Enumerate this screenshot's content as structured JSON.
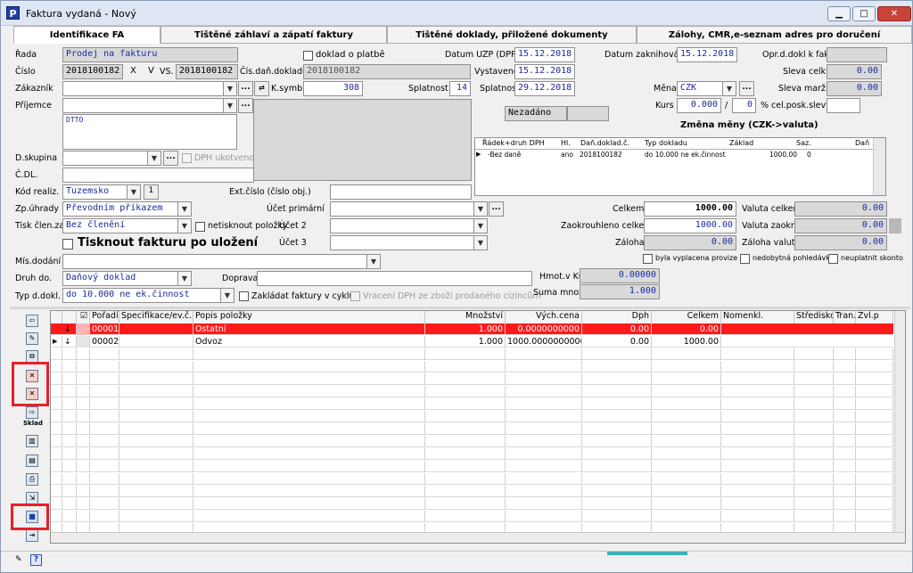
{
  "window": {
    "title": "Faktura vydaná - Nový",
    "app_logo": "P",
    "min": "▁",
    "max": "□",
    "close": "✕"
  },
  "tabs": [
    "Identifikace FA",
    "Tištěné záhlaví a zápatí faktury",
    "Tištěné doklady, přiložené dokumenty",
    "Zálohy, CMR,e-seznam adres pro doručení"
  ],
  "form": {
    "rada_label": "Řada",
    "rada_value": "Prodej na fakturu",
    "doklad_o_platbe": "doklad o platbě",
    "cislo_label": "Číslo",
    "cislo_value": "2018100182",
    "x_label": "X",
    "v_label": "V",
    "vs_label": "VS.",
    "vs_value": "2018100182",
    "cis_dan_label": "Čís.daň.dokladu",
    "cis_dan_value": "2018100182",
    "zakaznik_label": "Zákazník",
    "ksymb_label": "K.symb.",
    "ksymb_value": "308",
    "splatnost_label": "Splatnost",
    "splatnost_value": "14",
    "prijemce_label": "Příjemce",
    "prijemce_text": "DTTO",
    "dskupina_label": "D.skupina",
    "dph_ukotveno": "DPH ukotveno",
    "cdl_label": "Č.DL.",
    "kod_real_label": "Kód realiz.",
    "kod_real_value": "Tuzemsko",
    "kod_real_num": "1",
    "ext_cislo_label": "Ext.číslo (číslo obj.)",
    "zp_uhrady_label": "Zp.úhrady",
    "zp_uhrady_value": "Převodním příkazem",
    "ucet_prim_label": "Účet primární",
    "tisk_clen_label": "Tisk člen.za",
    "tisk_clen_value": "Bez členění",
    "netisknout_label": "netisknout položky",
    "ucet2_label": "Účet 2",
    "ucet3_label": "Účet 3",
    "tisknout_po_ulozeni": "Tisknout fakturu po uložení",
    "mis_dodani_label": "Mís.dodání",
    "druh_do_label": "Druh do.",
    "druh_do_value": "Daňový doklad",
    "doprava_label": "Doprava",
    "typ_dokl_label": "Typ d.dokl.",
    "typ_dokl_value": "do 10.000  ne ek.činnost",
    "zakladat_label": "Zakládat faktury v cyklu",
    "vraceni_label": "Vracení DPH ze zboží prodaného cizincům",
    "datum_uzp_label": "Datum UZP (DPPD)",
    "datum_uzp_value": "15.12.2018",
    "vystaveno_label": "Vystaveno",
    "vystaveno_value": "15.12.2018",
    "splatnost_d_label": "Splatnost",
    "splatnost_d_value": "29.12.2018",
    "datum_zak_label": "Datum zaknihování",
    "datum_zak_value": "15.12.2018",
    "opr_label": "Opr.d.dokl k fak.",
    "sleva_celk_label": "Sleva celk.",
    "sleva_celk_value": "0.00",
    "sleva_marz_label": "Sleva marž.",
    "sleva_marz_value": "0.00",
    "mena_label": "Měna",
    "mena_value": "CZK",
    "kurs_label": "Kurs",
    "kurs_value": "0.000",
    "kurs_slash": "/",
    "kurs_value2": "0",
    "cel_posk_label": "% cel.posk.slevy",
    "zmena_meny": "Změna měny (CZK->valuta)",
    "nezadano": "Nezadáno",
    "hmot_label": "Hmot.v KG",
    "hmot_value": "0.00000",
    "suma_label": "Suma množ.",
    "suma_value": "1.000",
    "celkem_label": "Celkem",
    "celkem_value": "1000.00",
    "zaokr_label": "Zaokrouhleno celkem",
    "zaokr_value": "1000.00",
    "zaloha_label": "Záloha",
    "zaloha_value": "0.00",
    "valuta_celkem_label": "Valuta celkem",
    "valuta_celkem_value": "0.00",
    "valuta_zaokr_label": "Valuta zaokr.",
    "valuta_zaokr_value": "0.00",
    "zaloha_valuta_label": "Záloha valuta",
    "zaloha_valuta_value": "0.00",
    "provize_label": "byla vyplacena provize ?",
    "nedobytna_label": "nedobytná pohledávka",
    "neuplatnit_label": "neuplatnit skonto",
    "dd_glyph": "▼",
    "dots": "..."
  },
  "vat_table": {
    "headers": [
      "Řádek+druh DPH",
      "Hl.",
      "Daň.doklad.č.",
      "Typ dokladu",
      "Základ",
      "Saz.",
      "Daň"
    ],
    "row": {
      "marker": "▶",
      "cells": [
        "-Bez daně",
        "ano",
        "2018100182",
        "do 10.000  ne ek.činnost",
        "1000.00",
        "0",
        ""
      ]
    }
  },
  "items_grid": {
    "headers": [
      "",
      "",
      "Pořadí",
      "Specifikace/ev.č.",
      "Popis položky",
      "Množství",
      "Vých.cena",
      "Dph",
      "Celkem",
      "Nomenkl.",
      "Středisko",
      "Tran.",
      "Zvl.p"
    ],
    "rows": [
      {
        "arrow": "↓",
        "poradi": "00001",
        "spec": "",
        "popis": "Ostatní",
        "mnozstvi": "1.000",
        "cena": "0.0000000000",
        "dph": "0.00",
        "celkem": "0.00",
        "highlight": true
      },
      {
        "arrow": "↓",
        "poradi": "00002",
        "spec": "",
        "popis": "Odvoz",
        "mnozstvi": "1.000",
        "cena": "1000.0000000000",
        "dph": "0.00",
        "celkem": "1000.00",
        "highlight": false
      }
    ]
  },
  "sidebar": {
    "sklad_label": "Sklad"
  },
  "colors": {
    "highlight_row": "#ff1a1a",
    "red_box": "#e8202a",
    "blue_text": "#1a2a9e"
  }
}
